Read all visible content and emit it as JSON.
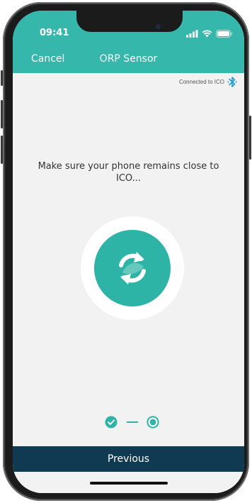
{
  "status_bar": {
    "time": "09:41",
    "icons": [
      "signal-icon",
      "wifi-icon",
      "battery-icon"
    ]
  },
  "header": {
    "cancel_label": "Cancel",
    "title": "ORP Sensor"
  },
  "connection": {
    "text": "Connected to ICO",
    "icon": "bluetooth-icon"
  },
  "main": {
    "message": "Make sure your phone remains close to ICO...",
    "spinner_icon": "sync-icon"
  },
  "stepper": {
    "steps": [
      {
        "state": "completed",
        "icon": "check-circle-icon"
      },
      {
        "state": "current",
        "icon": "radio-current-icon"
      }
    ]
  },
  "footer": {
    "previous_label": "Previous"
  },
  "colors": {
    "teal": "#36b7ab",
    "navy": "#0f3a52",
    "background": "#f2f2f2"
  }
}
